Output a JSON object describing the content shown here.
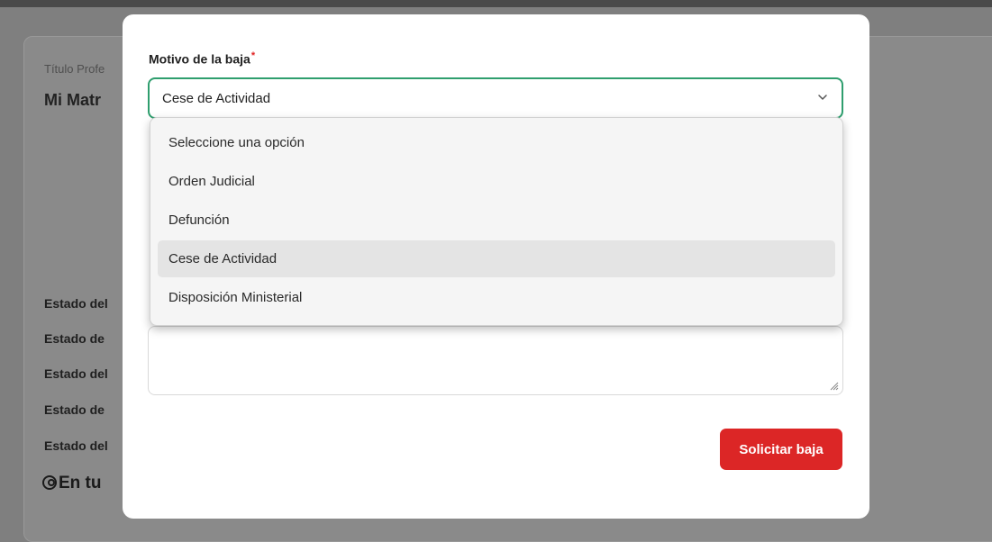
{
  "background": {
    "professional_title_label": "Título Profe",
    "registration_title": "Mi Matr",
    "status_lines": [
      "Estado del",
      "Estado de",
      "Estado del",
      "Estado de",
      "Estado del"
    ],
    "section_heading": "En tu"
  },
  "modal": {
    "reason_field": {
      "label": "Motivo de la baja",
      "required_mark": "*",
      "selected_value": "Cese de Actividad"
    },
    "submit_button": "Solicitar baja"
  },
  "dropdown": {
    "options": [
      "Seleccione una opción",
      "Orden Judicial",
      "Defunción",
      "Cese de Actividad",
      "Disposición Ministerial"
    ],
    "highlighted": "Cese de Actividad"
  },
  "colors": {
    "overlay": "#7f7f7f",
    "focus_border": "#2f9e6e",
    "primary_danger": "#dc2626",
    "required": "#e02424"
  },
  "icons": [
    "chevron-down-icon",
    "resize-grip-icon",
    "user-circle-icon"
  ]
}
